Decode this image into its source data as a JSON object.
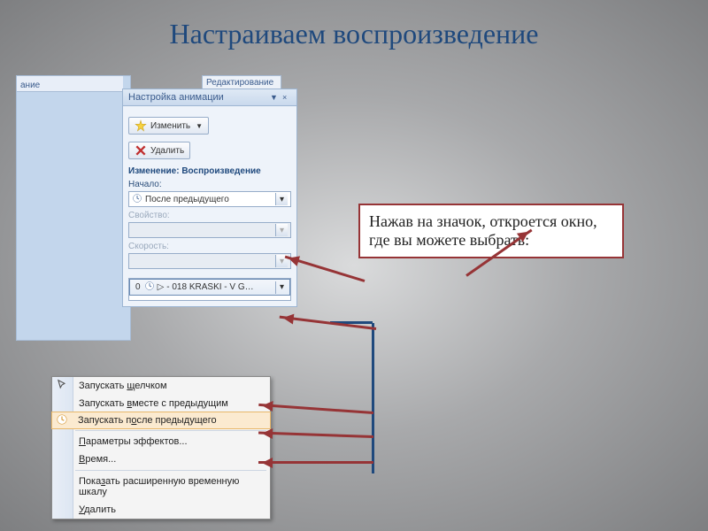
{
  "slide": {
    "title": "Настраиваем воспроизведение"
  },
  "ribbon": {
    "frag1": "ание",
    "frag2": "Редактирование"
  },
  "taskpane": {
    "title": "Настройка анимации",
    "change_btn": "Изменить",
    "remove_btn": "Удалить",
    "section": "Изменение: Воспроизведение",
    "start_label": "Начало:",
    "start_value": "После предыдущего",
    "property_label": "Свойство:",
    "speed_label": "Скорость:",
    "anim_item": {
      "index": "0",
      "name": "- 018 KRASKI - V G…"
    }
  },
  "context_menu": {
    "items": [
      "Запускать щелчком",
      "Запускать вместе с предыдущим",
      "Запускать после предыдущего",
      "Параметры эффектов...",
      "Время...",
      "Показать расширенную временную шкалу",
      "Удалить"
    ],
    "accel_positions": [
      10,
      10,
      11,
      0,
      0,
      4,
      0
    ]
  },
  "callout": {
    "text": "Нажав на значок, откроется окно, где вы можете выбрать:"
  }
}
